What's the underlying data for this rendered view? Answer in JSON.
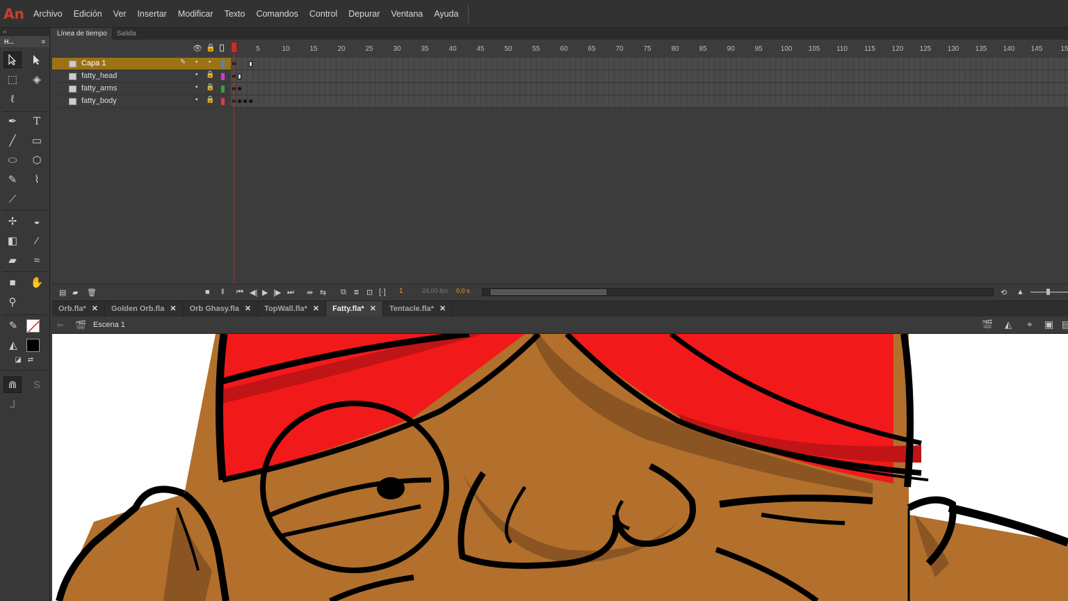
{
  "app": {
    "logo": "An"
  },
  "menu": [
    "Archivo",
    "Edición",
    "Ver",
    "Insertar",
    "Modificar",
    "Texto",
    "Comandos",
    "Control",
    "Depurar",
    "Ventana",
    "Ayuda"
  ],
  "toolbar": {
    "collapse": "‹‹",
    "title": "H...",
    "tools": [
      "selection-tool",
      "subselection-tool",
      "free-transform-tool",
      "3d-rotation-tool",
      "lasso-tool",
      "pen-tool",
      "text-tool",
      "line-tool",
      "rectangle-tool",
      "oval-tool",
      "polystar-tool",
      "pencil-tool",
      "brush-tool",
      "paint-brush-tool",
      "bone-tool",
      "paint-bucket-tool",
      "ink-bottle-tool",
      "eyedropper-tool",
      "eraser-tool",
      "width-tool",
      "camera-tool",
      "hand-tool",
      "zoom-tool"
    ]
  },
  "timeline": {
    "tabs": [
      "Línea de tiempo",
      "Salida"
    ],
    "ruler_labels": [
      "1",
      "5",
      "10",
      "15",
      "20",
      "25",
      "30",
      "35",
      "40",
      "45",
      "50",
      "55",
      "60",
      "65",
      "70",
      "75",
      "80",
      "85",
      "90",
      "95",
      "100",
      "105",
      "110",
      "115",
      "120",
      "125",
      "130",
      "135",
      "140",
      "145",
      "15"
    ],
    "layers": [
      {
        "name": "Capa 1",
        "color": "#4f7fd8",
        "selected": true
      },
      {
        "name": "fatty_head",
        "color": "#d03ad0",
        "selected": false
      },
      {
        "name": "fatty_arms",
        "color": "#3aa03a",
        "selected": false
      },
      {
        "name": "fatty_body",
        "color": "#e03a3a",
        "selected": false
      }
    ],
    "footer": {
      "current_frame": "1",
      "fps": "24,00 fps",
      "time": "0,0 s"
    }
  },
  "documents": [
    {
      "name": "Orb.fla*",
      "active": false
    },
    {
      "name": "Golden Orb.fla",
      "active": false
    },
    {
      "name": "Orb Ghasy.fla",
      "active": false
    },
    {
      "name": "TopWall.fla*",
      "active": false
    },
    {
      "name": "Fatty.fla*",
      "active": true
    },
    {
      "name": "Tentacle.fla*",
      "active": false
    }
  ],
  "editbar": {
    "scene": "Escena 1"
  },
  "colors": {
    "turban_red": "#f2191b",
    "skin": "#b2702c",
    "skin_shadow": "#8a5523",
    "outline": "#000000",
    "selected_layer": "#9b7316"
  }
}
